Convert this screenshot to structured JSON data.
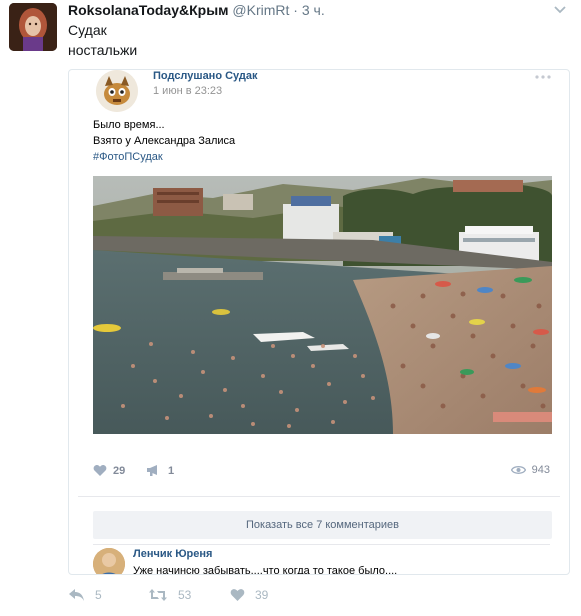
{
  "tweet": {
    "author_name": "RoksolanaToday&Крым",
    "handle": "@KrimRt",
    "separator": "·",
    "time": "3 ч.",
    "text_lines": [
      "Судак",
      "ностальжи"
    ]
  },
  "vk_post": {
    "group_name": "Подслушано Судак",
    "date": "1 июн в 23:23",
    "text_lines": [
      "Было время...",
      "Взято у Александра Залиса"
    ],
    "hashtag": "#ФотоПСудак",
    "likes": "29",
    "shares": "1",
    "views": "943",
    "show_comments_label": "Показать все 7 комментариев",
    "comment": {
      "author": "Ленчик Юреня",
      "text": "Уже начинсю забывать....что когда то такое было...."
    }
  },
  "tweet_actions": {
    "replies": "5",
    "retweets": "53",
    "likes": "39"
  },
  "icons": {
    "like": "heart-icon",
    "share": "megaphone-icon",
    "views": "eye-icon",
    "reply": "reply-arrow-icon",
    "retweet": "retweet-icon",
    "tweet_like": "heart-icon",
    "menu": "chevron-down-icon",
    "vk_menu": "more-dots-icon"
  },
  "colors": {
    "vk_link": "#2a5885",
    "twitter_icon_gray": "#aab8c2",
    "vk_icon_gray": "#828a99"
  }
}
